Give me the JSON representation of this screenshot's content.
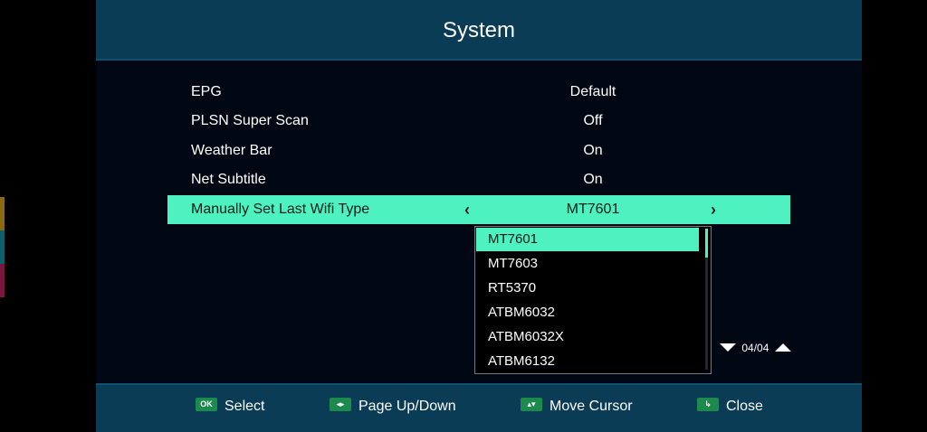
{
  "header": {
    "title": "System"
  },
  "menu": {
    "items": [
      {
        "label": "EPG",
        "value": "Default"
      },
      {
        "label": "PLSN Super Scan",
        "value": "Off"
      },
      {
        "label": "Weather Bar",
        "value": "On"
      },
      {
        "label": "Net Subtitle",
        "value": "On"
      },
      {
        "label": "Manually Set Last Wifi Type",
        "value": "MT7601",
        "selected": true
      }
    ],
    "left_arrow": "‹",
    "right_arrow": "›"
  },
  "dropdown": {
    "options": [
      "MT7601",
      "MT7603",
      "RT5370",
      "ATBM6032",
      "ATBM6032X",
      "ATBM6132"
    ],
    "selected": "MT7601"
  },
  "pager": {
    "text": "04/04"
  },
  "footer": {
    "hints": [
      {
        "key": "OK",
        "icon": "ok-key-icon",
        "label": "Select"
      },
      {
        "key": "◂▸",
        "icon": "left-right-key-icon",
        "label": "Page Up/Down"
      },
      {
        "key": "▴▾",
        "icon": "up-down-key-icon",
        "label": "Move Cursor"
      },
      {
        "key": "↳",
        "icon": "exit-key-icon",
        "label": "Close"
      }
    ]
  },
  "colors": {
    "accent": "#4ef2c0",
    "header_bg": "#0b3c55",
    "screen_bg": "#020714",
    "key_green": "#1d8a4d",
    "strip": [
      "#8a6a10",
      "#0d5f6a",
      "#7a1540"
    ]
  }
}
